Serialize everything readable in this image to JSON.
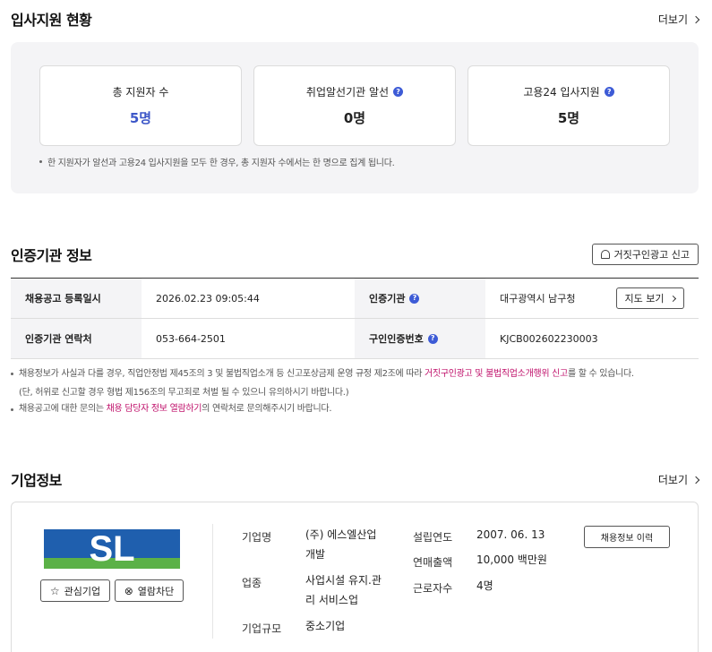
{
  "applicants": {
    "title": "입사지원 현황",
    "more_label": "더보기",
    "cards": [
      {
        "label": "총 지원자 수",
        "value": "5명"
      },
      {
        "label": "취업알선기관 알선",
        "value": "0명"
      },
      {
        "label": "고용24 입사지원",
        "value": "5명"
      }
    ],
    "note": "한 지원자가 알선과 고용24 입사지원을 모두 한 경우, 총 지원자 수에서는 한 명으로 집계 됩니다.",
    "accent_color": "#3d57c8"
  },
  "certification": {
    "title": "인증기관 정보",
    "report_button": "거짓구인광고 신고",
    "rows": [
      {
        "label1": "채용공고 등록일시",
        "value1": "2026.02.23 09:05:44",
        "label2": "인증기관",
        "value2": "대구광역시 남구청"
      },
      {
        "label1": "인증기관 연락처",
        "value1": "053-664-2501",
        "label2": "구인인증번호",
        "value2": "KJCB002602230003"
      }
    ],
    "map_button": "지도 보기",
    "notice1_prefix": "채용정보가 사실과 다를 경우, 직업안정법 제45조의 3 및 불법직업소개 등 신고포상금제 운영 규정 제2조에 따라 ",
    "notice1_link": "거짓구인광고 및 불법직업소개행위 신고",
    "notice1_suffix": "를 할 수 있습니다.",
    "notice1_line2": "(단, 허위로 신고할 경우 형법 제156조의 무고죄로 처벌 될 수 있으니 유의하시기 바랍니다.)",
    "notice2_prefix": "채용공고에 대한 문의는 ",
    "notice2_link": "채용 담당자 정보 열람하기",
    "notice2_suffix": "의 연락처로 문의해주시기 바랍니다.",
    "link_color": "#c0136c"
  },
  "company": {
    "title": "기업정보",
    "more_label": "더보기",
    "logo_text": "SL",
    "interest_button": "관심기업",
    "block_button": "열람차단",
    "history_button": "채용정보 이력",
    "fields": {
      "name_label": "기업명",
      "name_line1": "(주) 에스엘산업",
      "name_line2": "개발",
      "industry_label": "업종",
      "industry_line1": "사업시설 유지.관",
      "industry_line2": "리 서비스업",
      "size_label": "기업규모",
      "size_value": "중소기업",
      "founded_label": "설립연도",
      "founded_value": "2007. 06. 13",
      "sales_label": "연매출액",
      "sales_value": "10,000 백만원",
      "employees_label": "근로자수",
      "employees_value": "4명"
    }
  }
}
